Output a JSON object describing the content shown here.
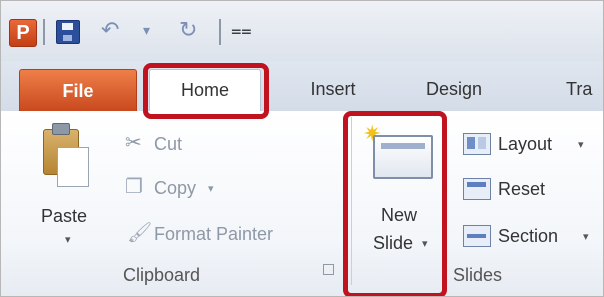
{
  "quick_access_toolbar": {
    "app_icon": "powerpoint-icon",
    "app_letter": "P",
    "save_icon": "save-icon",
    "undo_glyph": "↶",
    "undo_dropdown_glyph": "▾",
    "redo_glyph": "↻",
    "customize_glyph": "⩵"
  },
  "tabs": {
    "file": "File",
    "home": "Home",
    "insert": "Insert",
    "design": "Design",
    "transitions_partial": "Tra"
  },
  "clipboard": {
    "paste_label": "Paste",
    "paste_arrow": "▾",
    "cut_label": "Cut",
    "copy_label": "Copy",
    "copy_arrow": "▾",
    "format_painter_label": "Format Painter",
    "group_label": "Clipboard"
  },
  "slides": {
    "new_label_line1": "New",
    "new_label_line2": "Slide",
    "new_arrow": "▾",
    "layout_label": "Layout",
    "layout_arrow": "▾",
    "reset_label": "Reset",
    "section_label": "Section",
    "section_arrow": "▾",
    "group_label": "Slides"
  },
  "highlight_color": "#c1121f",
  "file_tab_color": "#d9592b"
}
